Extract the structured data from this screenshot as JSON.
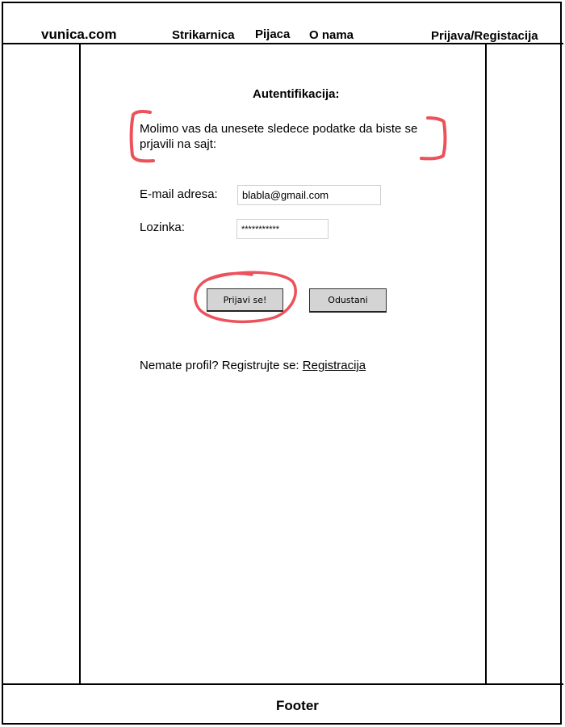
{
  "header": {
    "logo": "vunica.com",
    "nav": [
      "Strikarnica",
      "Pijaca",
      "O nama",
      "Prijava/Registacija"
    ]
  },
  "form": {
    "title": "Autentifikacija:",
    "instruction": "Molimo vas da unesete sledece podatke da biste se prjavili na sajt:",
    "email_label": "E-mail adresa:",
    "email_value": "blabla@gmail.com",
    "password_label": "Lozinka:",
    "password_value": "***********",
    "login_button": "Prijavi se!",
    "cancel_button": "Odustani",
    "register_prompt": "Nemate profil? Registrujte se: ",
    "register_link": "Registracija"
  },
  "footer": {
    "label": "Footer"
  },
  "colors": {
    "annotation": "#e8343e",
    "button": "#d4d4d4",
    "border": "#000000"
  }
}
